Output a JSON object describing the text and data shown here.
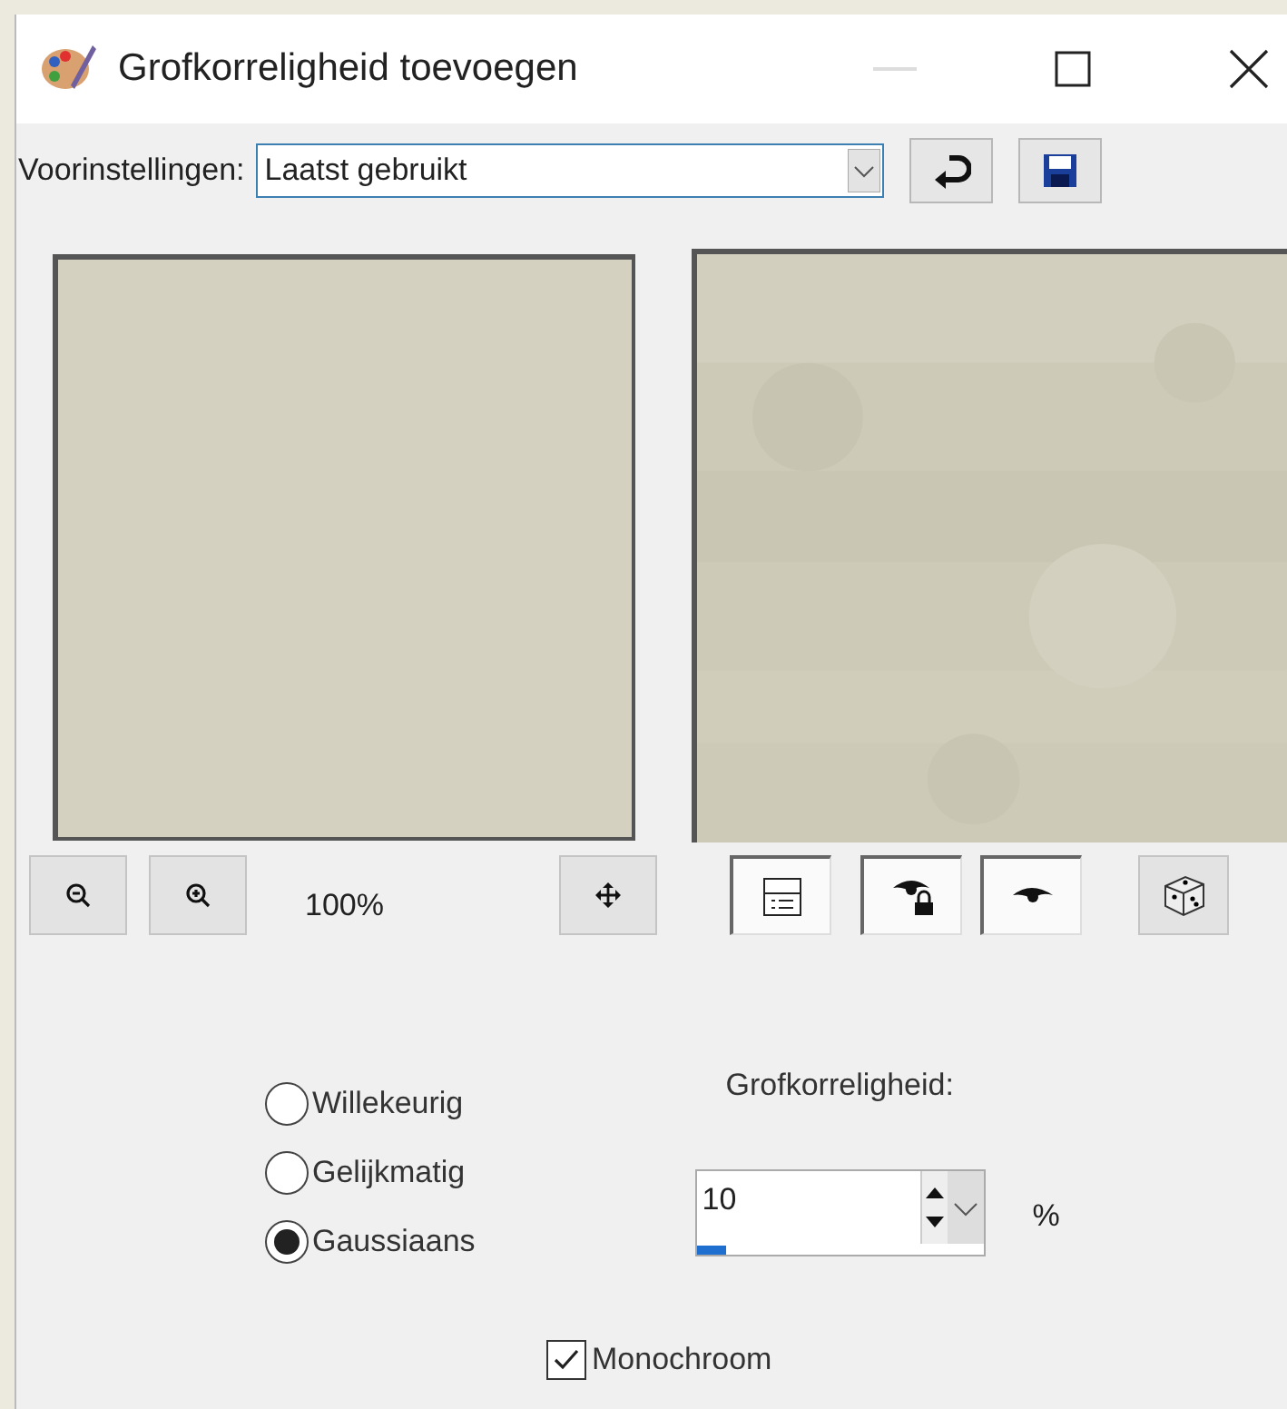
{
  "window": {
    "title": "Grofkorreligheid toevoegen"
  },
  "presets": {
    "label": "Voorinstellingen:",
    "value": "Laatst gebruikt"
  },
  "zoom": {
    "reading": "100%"
  },
  "noise_types": [
    {
      "label": "Willekeurig",
      "selected": false
    },
    {
      "label": "Gelijkmatig",
      "selected": false
    },
    {
      "label": "Gaussiaans",
      "selected": true
    }
  ],
  "amount": {
    "label": "Grofkorreligheid:",
    "value": "10",
    "unit": "%",
    "level": 0.1
  },
  "monochrome": {
    "label": "Monochroom",
    "checked": true
  }
}
